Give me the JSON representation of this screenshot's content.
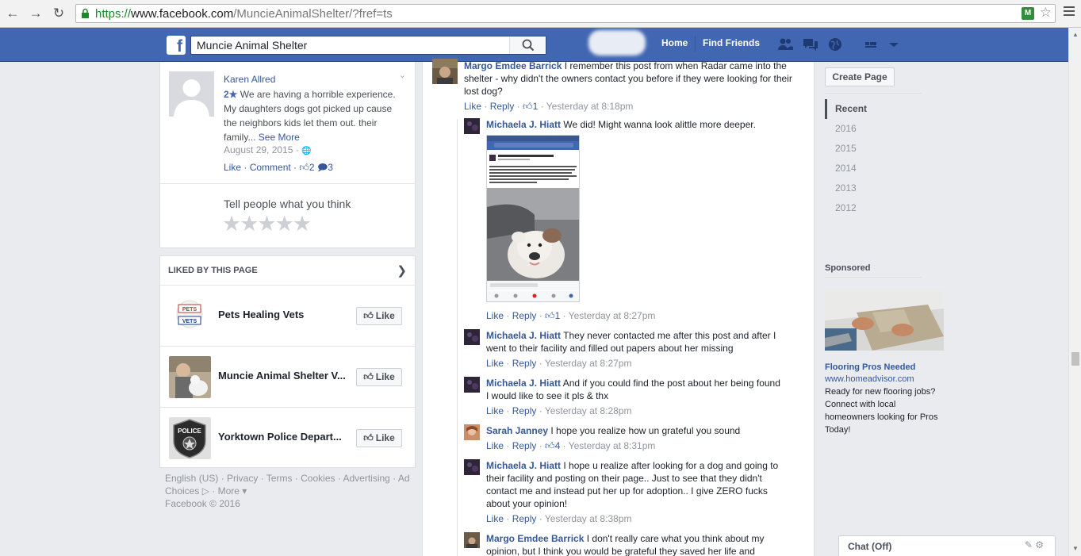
{
  "browser": {
    "url_scheme": "https://",
    "url_host": "www.facebook.com",
    "url_path": "/MuncieAnimalShelter/?fref=ts"
  },
  "topbar": {
    "logo": "f",
    "search_value": "Muncie Animal Shelter",
    "home": "Home",
    "find_friends": "Find Friends"
  },
  "review": {
    "name": "Karen Allred",
    "rating": "2★",
    "text": " We are having a horrible experience. My daughters dogs got picked up cause the neighbors kids let them out. their family...",
    "see_more": "See More",
    "date": "August 29, 2015 · ",
    "like": "Like",
    "comment": "Comment",
    "like_count": "2",
    "comment_count": "3",
    "tell_prompt": "Tell people what you think",
    "stars": "★★★★★"
  },
  "liked": {
    "header": "LIKED BY THIS PAGE",
    "like_label": "Like",
    "pages": [
      {
        "name": "Pets Healing Vets"
      },
      {
        "name": "Muncie Animal Shelter V..."
      },
      {
        "name": "Yorktown Police Depart..."
      }
    ]
  },
  "footer": {
    "links": "English (US) · Privacy · Terms · Cookies · Advertising · Ad Choices",
    "more": " · More ▾",
    "copyright": "Facebook © 2016"
  },
  "comments": [
    {
      "name": "Margo Emdee Barrick",
      "text": " I remember this post from when Radar came into the shelter - why didn't the owners contact you before if they were looking for their lost dog?",
      "like": "Like",
      "reply": "Reply",
      "likes": "1",
      "time": "Yesterday at 8:18pm"
    },
    {
      "name": "Michaela J. Hiatt",
      "text": " We did! Might wanna look alittle more deeper.",
      "like": "Like",
      "reply": "Reply",
      "likes": "1",
      "time": "Yesterday at 8:27pm"
    },
    {
      "name": "Michaela J. Hiatt",
      "text": " They never contacted me after this post and after I went to their facility and filled out papers about her missing",
      "like": "Like",
      "reply": "Reply",
      "time": "Yesterday at 8:27pm"
    },
    {
      "name": "Michaela J. Hiatt",
      "text": " And if you could find the post about her being found I would like to see it pls & thx",
      "like": "Like",
      "reply": "Reply",
      "time": "Yesterday at 8:28pm"
    },
    {
      "name": "Sarah Janney",
      "text": " I hope you realize how un grateful you sound",
      "like": "Like",
      "reply": "Reply",
      "likes": "4",
      "time": "Yesterday at 8:31pm"
    },
    {
      "name": "Michaela J. Hiatt",
      "text": " I hope u realize after looking for a dog and going to their facility and posting on their page.. Just to see that they didn't contact me and instead put her up for adoption.. I give ZERO fucks about your opinion!",
      "like": "Like",
      "reply": "Reply",
      "time": "Yesterday at 8:38pm"
    },
    {
      "name": "Margo Emdee Barrick",
      "text": " I don't really care what you think about my opinion, but I think you would be grateful they saved her life and"
    }
  ],
  "right": {
    "create_page": "Create Page",
    "years": [
      "Recent",
      "2016",
      "2015",
      "2014",
      "2013",
      "2012"
    ],
    "sponsored": "Sponsored",
    "ad_title": "Flooring Pros Needed",
    "ad_url": "www.homeadvisor.com",
    "ad_desc": "Ready for new flooring jobs? Connect with local homeowners looking for Pros Today!"
  },
  "chat": {
    "label": "Chat (Off)"
  },
  "colors": {
    "fb_blue": "#4267b2",
    "link": "#365899"
  }
}
